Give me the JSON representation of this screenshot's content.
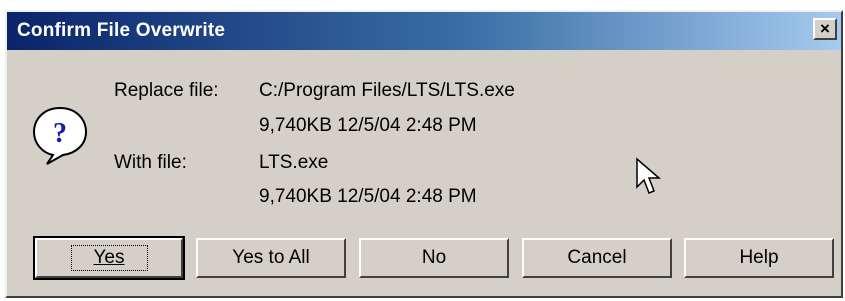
{
  "dialog": {
    "title": "Confirm File Overwrite",
    "close_label": "×",
    "replace_label": "Replace file:",
    "replace_path": "C:/Program Files/LTS/LTS.exe",
    "replace_info": "9,740KB  12/5/04  2:48 PM",
    "with_label": "With file:",
    "with_name": "LTS.exe",
    "with_info": "9,740KB  12/5/04  2:48 PM"
  },
  "icons": {
    "question": "question-icon",
    "cursor": "mouse-pointer-icon"
  },
  "buttons": {
    "yes": "Yes",
    "yes_to_all": "Yes to All",
    "no": "No",
    "cancel": "Cancel",
    "help": "Help"
  },
  "colors": {
    "titlebar_start": "#0a246a",
    "titlebar_end": "#a6caf0",
    "face": "#d4d0c8"
  }
}
